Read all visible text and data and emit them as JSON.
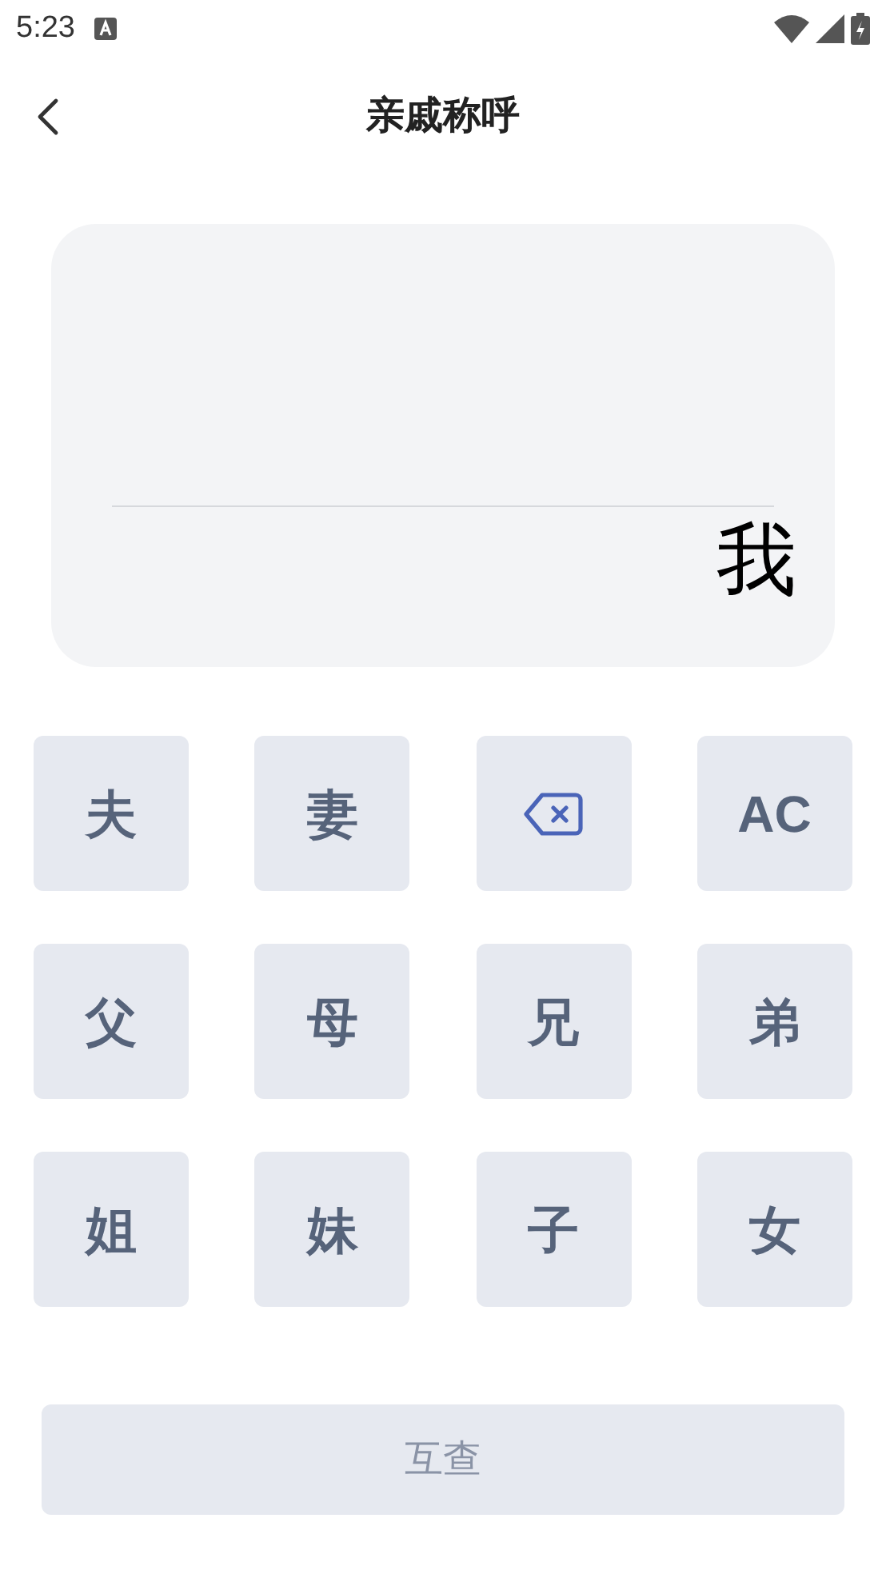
{
  "status_bar": {
    "time": "5:23"
  },
  "header": {
    "title": "亲戚称呼"
  },
  "display": {
    "result": "我"
  },
  "keys": [
    {
      "kind": "char",
      "label": "夫"
    },
    {
      "kind": "char",
      "label": "妻"
    },
    {
      "kind": "backspace"
    },
    {
      "kind": "clear",
      "label": "AC"
    },
    {
      "kind": "char",
      "label": "父"
    },
    {
      "kind": "char",
      "label": "母"
    },
    {
      "kind": "char",
      "label": "兄"
    },
    {
      "kind": "char",
      "label": "弟"
    },
    {
      "kind": "char",
      "label": "姐"
    },
    {
      "kind": "char",
      "label": "妹"
    },
    {
      "kind": "char",
      "label": "子"
    },
    {
      "kind": "char",
      "label": "女"
    }
  ],
  "submit": {
    "label": "互查",
    "disabled": true
  }
}
